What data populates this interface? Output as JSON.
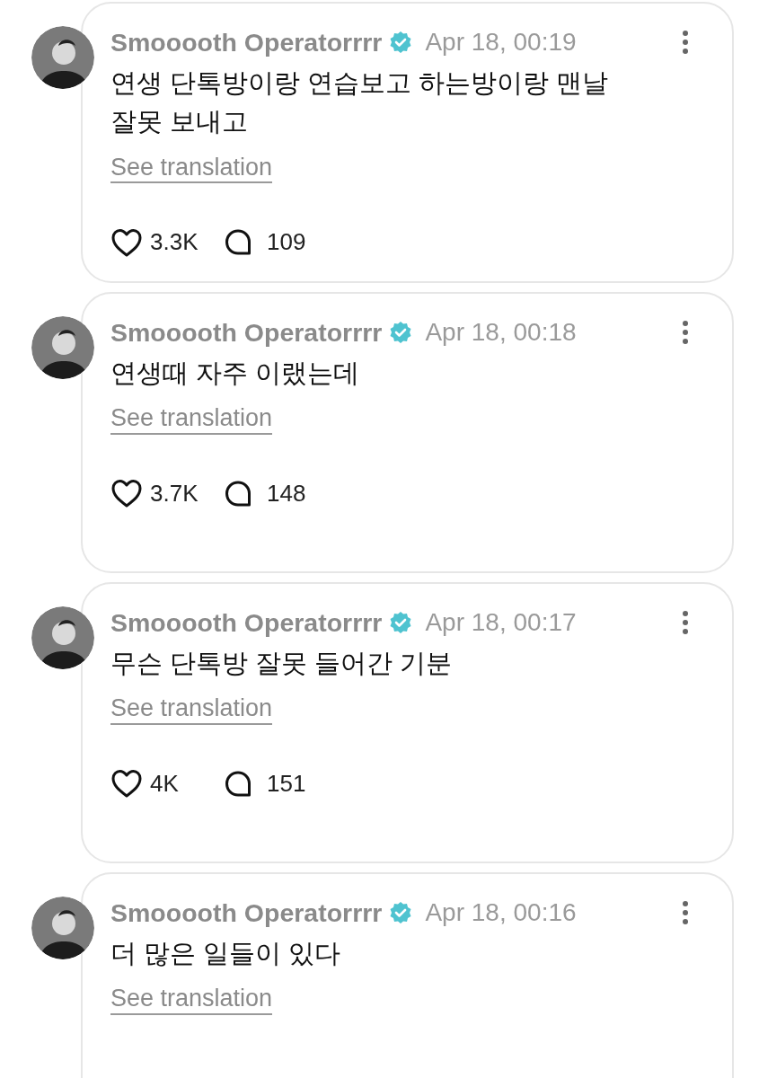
{
  "posts": [
    {
      "author": "Smooooth Operatorrrr",
      "verified": true,
      "time": "Apr 18, 00:19",
      "text": "연생 단톡방이랑 연습보고 하는방이랑 맨날\n잘못 보내고",
      "translate": "See translation",
      "likes": "3.3K",
      "replies": "109"
    },
    {
      "author": "Smooooth Operatorrrr",
      "verified": true,
      "time": "Apr 18, 00:18",
      "text": "연생때 자주 이랬는데",
      "translate": "See translation",
      "likes": "3.7K",
      "replies": "148"
    },
    {
      "author": "Smooooth Operatorrrr",
      "verified": true,
      "time": "Apr 18, 00:17",
      "text": "무슨 단톡방 잘못 들어간 기분",
      "translate": "See translation",
      "likes": "4K",
      "replies": "151"
    },
    {
      "author": "Smooooth Operatorrrr",
      "verified": true,
      "time": "Apr 18, 00:16",
      "text": "더 많은 일들이 있다",
      "translate": "See translation"
    }
  ]
}
